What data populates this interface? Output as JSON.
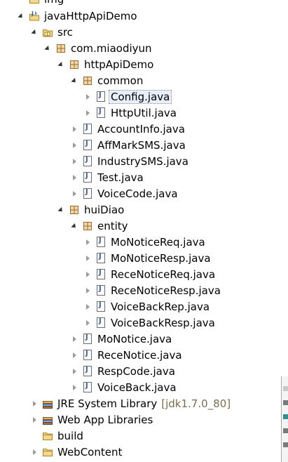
{
  "tree": [
    {
      "label": "img",
      "icon": "folder-icon",
      "depth": 0,
      "state": "none",
      "y": -13
    },
    {
      "label": "javaHttpApiDemo",
      "icon": "java-project-icon",
      "depth": 0,
      "state": "expanded"
    },
    {
      "label": "src",
      "icon": "source-folder-icon",
      "depth": 1,
      "state": "expanded"
    },
    {
      "label": "com.miaodiyun",
      "icon": "package-icon",
      "depth": 2,
      "state": "expanded"
    },
    {
      "label": "httpApiDemo",
      "icon": "package-icon",
      "depth": 3,
      "state": "expanded"
    },
    {
      "label": "common",
      "icon": "package-icon",
      "depth": 4,
      "state": "expanded"
    },
    {
      "label": "Config.java",
      "icon": "java-file-icon",
      "depth": 5,
      "state": "collapsed",
      "selected": true
    },
    {
      "label": "HttpUtil.java",
      "icon": "java-file-icon",
      "depth": 5,
      "state": "collapsed"
    },
    {
      "label": "AccountInfo.java",
      "icon": "java-file-icon",
      "depth": 4,
      "state": "collapsed"
    },
    {
      "label": "AffMarkSMS.java",
      "icon": "java-file-icon",
      "depth": 4,
      "state": "collapsed"
    },
    {
      "label": "IndustrySMS.java",
      "icon": "java-file-icon",
      "depth": 4,
      "state": "collapsed"
    },
    {
      "label": "Test.java",
      "icon": "java-file-icon",
      "depth": 4,
      "state": "collapsed"
    },
    {
      "label": "VoiceCode.java",
      "icon": "java-file-icon",
      "depth": 4,
      "state": "collapsed"
    },
    {
      "label": "huiDiao",
      "icon": "package-icon",
      "depth": 3,
      "state": "expanded"
    },
    {
      "label": "entity",
      "icon": "package-icon",
      "depth": 4,
      "state": "expanded"
    },
    {
      "label": "MoNoticeReq.java",
      "icon": "java-file-icon",
      "depth": 5,
      "state": "collapsed"
    },
    {
      "label": "MoNoticeResp.java",
      "icon": "java-file-icon",
      "depth": 5,
      "state": "collapsed"
    },
    {
      "label": "ReceNoticeReq.java",
      "icon": "java-file-icon",
      "depth": 5,
      "state": "collapsed"
    },
    {
      "label": "ReceNoticeResp.java",
      "icon": "java-file-icon",
      "depth": 5,
      "state": "collapsed"
    },
    {
      "label": "VoiceBackRep.java",
      "icon": "java-file-icon",
      "depth": 5,
      "state": "collapsed"
    },
    {
      "label": "VoiceBackResp.java",
      "icon": "java-file-icon",
      "depth": 5,
      "state": "collapsed"
    },
    {
      "label": "MoNotice.java",
      "icon": "java-file-icon",
      "depth": 4,
      "state": "collapsed"
    },
    {
      "label": "ReceNotice.java",
      "icon": "java-file-icon",
      "depth": 4,
      "state": "collapsed"
    },
    {
      "label": "RespCode.java",
      "icon": "java-file-icon",
      "depth": 4,
      "state": "collapsed"
    },
    {
      "label": "VoiceBack.java",
      "icon": "java-file-icon",
      "depth": 4,
      "state": "collapsed"
    },
    {
      "label": "JRE System Library",
      "decor": "[jdk1.7.0_80]",
      "icon": "library-icon",
      "depth": 1,
      "state": "collapsed"
    },
    {
      "label": "Web App Libraries",
      "icon": "library-icon",
      "depth": 1,
      "state": "collapsed"
    },
    {
      "label": "build",
      "icon": "folder-icon",
      "depth": 1,
      "state": "none"
    },
    {
      "label": "WebContent",
      "icon": "folder-icon",
      "depth": 1,
      "state": "collapsed"
    }
  ],
  "colors": {
    "background": "#ffffff",
    "decoration_text": "#7d6b4a",
    "selection": "#e8eefa"
  }
}
